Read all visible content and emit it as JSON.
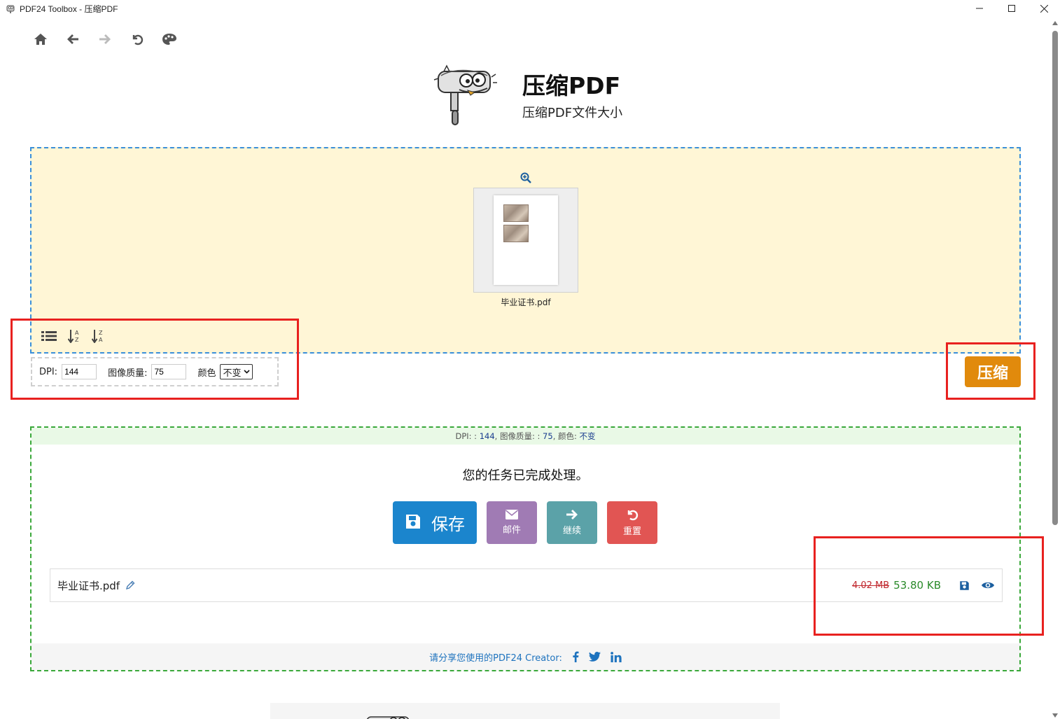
{
  "window": {
    "title": "PDF24 Toolbox - 压缩PDF"
  },
  "header": {
    "title": "压缩PDF",
    "subtitle": "压缩PDF文件大小"
  },
  "dropzone": {
    "file_name": "毕业证书.pdf"
  },
  "options": {
    "dpi_label": "DPI:",
    "dpi_value": "144",
    "quality_label": "图像质量:",
    "quality_value": "75",
    "color_label": "颜色",
    "color_selected": "不变"
  },
  "compress_label": "压缩",
  "result": {
    "info_dpi_label": "DPI: :",
    "info_dpi_value": "144",
    "info_quality_label": ", 图像质量: :",
    "info_quality_value": "75",
    "info_color_label": ", 颜色:",
    "info_color_value": "不变",
    "done_message": "您的任务已完成处理。",
    "save_label": "保存",
    "mail_label": "邮件",
    "continue_label": "继续",
    "reset_label": "重置",
    "file_name": "毕业证书.pdf",
    "old_size": "4.02 MB",
    "new_size": "53.80 KB",
    "share_text": "请分享您使用的PDF24 Creator:"
  },
  "colors": {
    "compress_button": "#e18a0c",
    "save_button": "#1b85cd",
    "mail_button": "#a07bb4",
    "continue_button": "#5ba2a8",
    "reset_button": "#e15553",
    "highlight_box": "#e8211f"
  }
}
